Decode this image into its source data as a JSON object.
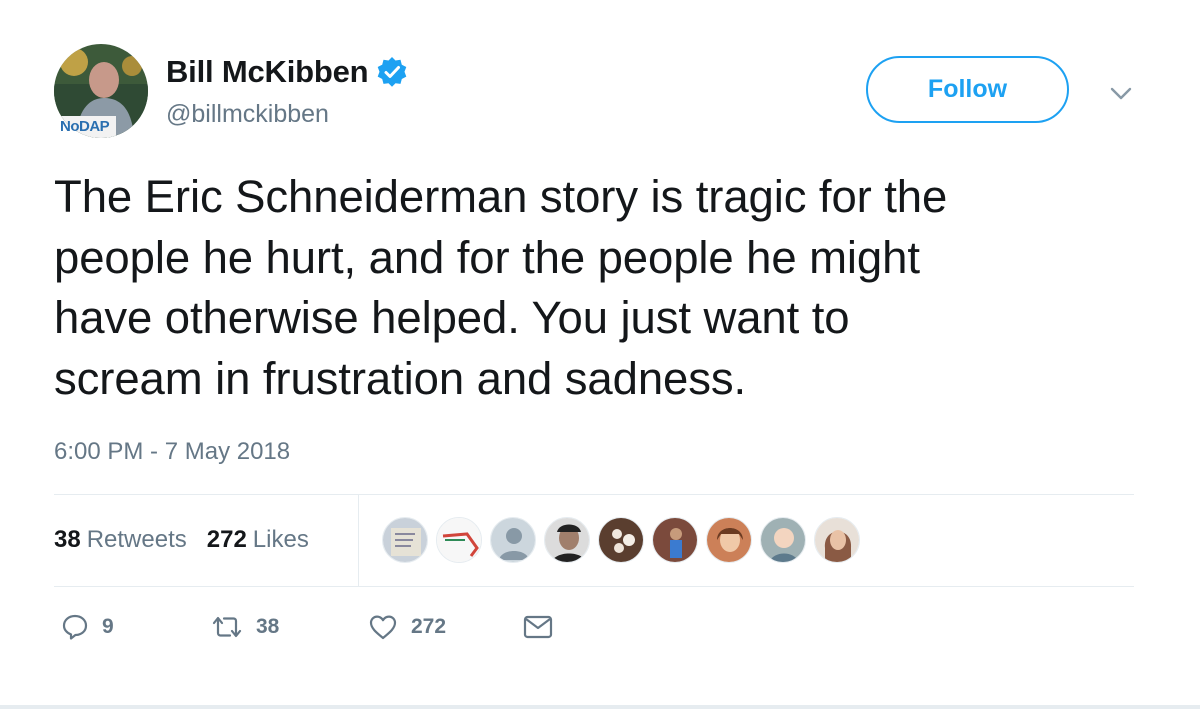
{
  "author": {
    "display_name": "Bill McKibben",
    "handle": "@billmckibben",
    "verified": true,
    "avatar_banner_text": "NoDAP"
  },
  "follow_button": {
    "label": "Follow"
  },
  "menu": {
    "icon": "chevron-down-icon"
  },
  "tweet": {
    "text": "The Eric Schneiderman story is tragic for the\npeople he hurt, and for the people he might\nhave otherwise helped. You just want to\nscream in frustration and sadness.",
    "timestamp": "6:00 PM - 7 May 2018"
  },
  "stats": {
    "retweets_count": "38",
    "retweets_label": "Retweets",
    "likes_count": "272",
    "likes_label": "Likes"
  },
  "likers": [
    {
      "name": "liker-avatar-1",
      "color": "#b9c3cf"
    },
    {
      "name": "liker-avatar-2",
      "color": "#f2f2f2"
    },
    {
      "name": "liker-avatar-3",
      "color": "#ccd6dd"
    },
    {
      "name": "liker-avatar-4",
      "color": "#3a3a3a"
    },
    {
      "name": "liker-avatar-5",
      "color": "#6b4a3a"
    },
    {
      "name": "liker-avatar-6",
      "color": "#7a4b3c"
    },
    {
      "name": "liker-avatar-7",
      "color": "#c97a56"
    },
    {
      "name": "liker-avatar-8",
      "color": "#8fa3a8"
    },
    {
      "name": "liker-avatar-9",
      "color": "#9a7060"
    }
  ],
  "actions": {
    "reply_count": "9",
    "retweet_count": "38",
    "like_count": "272"
  },
  "colors": {
    "accent": "#1da1f2",
    "text": "#14171a",
    "muted": "#657786",
    "divider": "#e6ecf0"
  }
}
